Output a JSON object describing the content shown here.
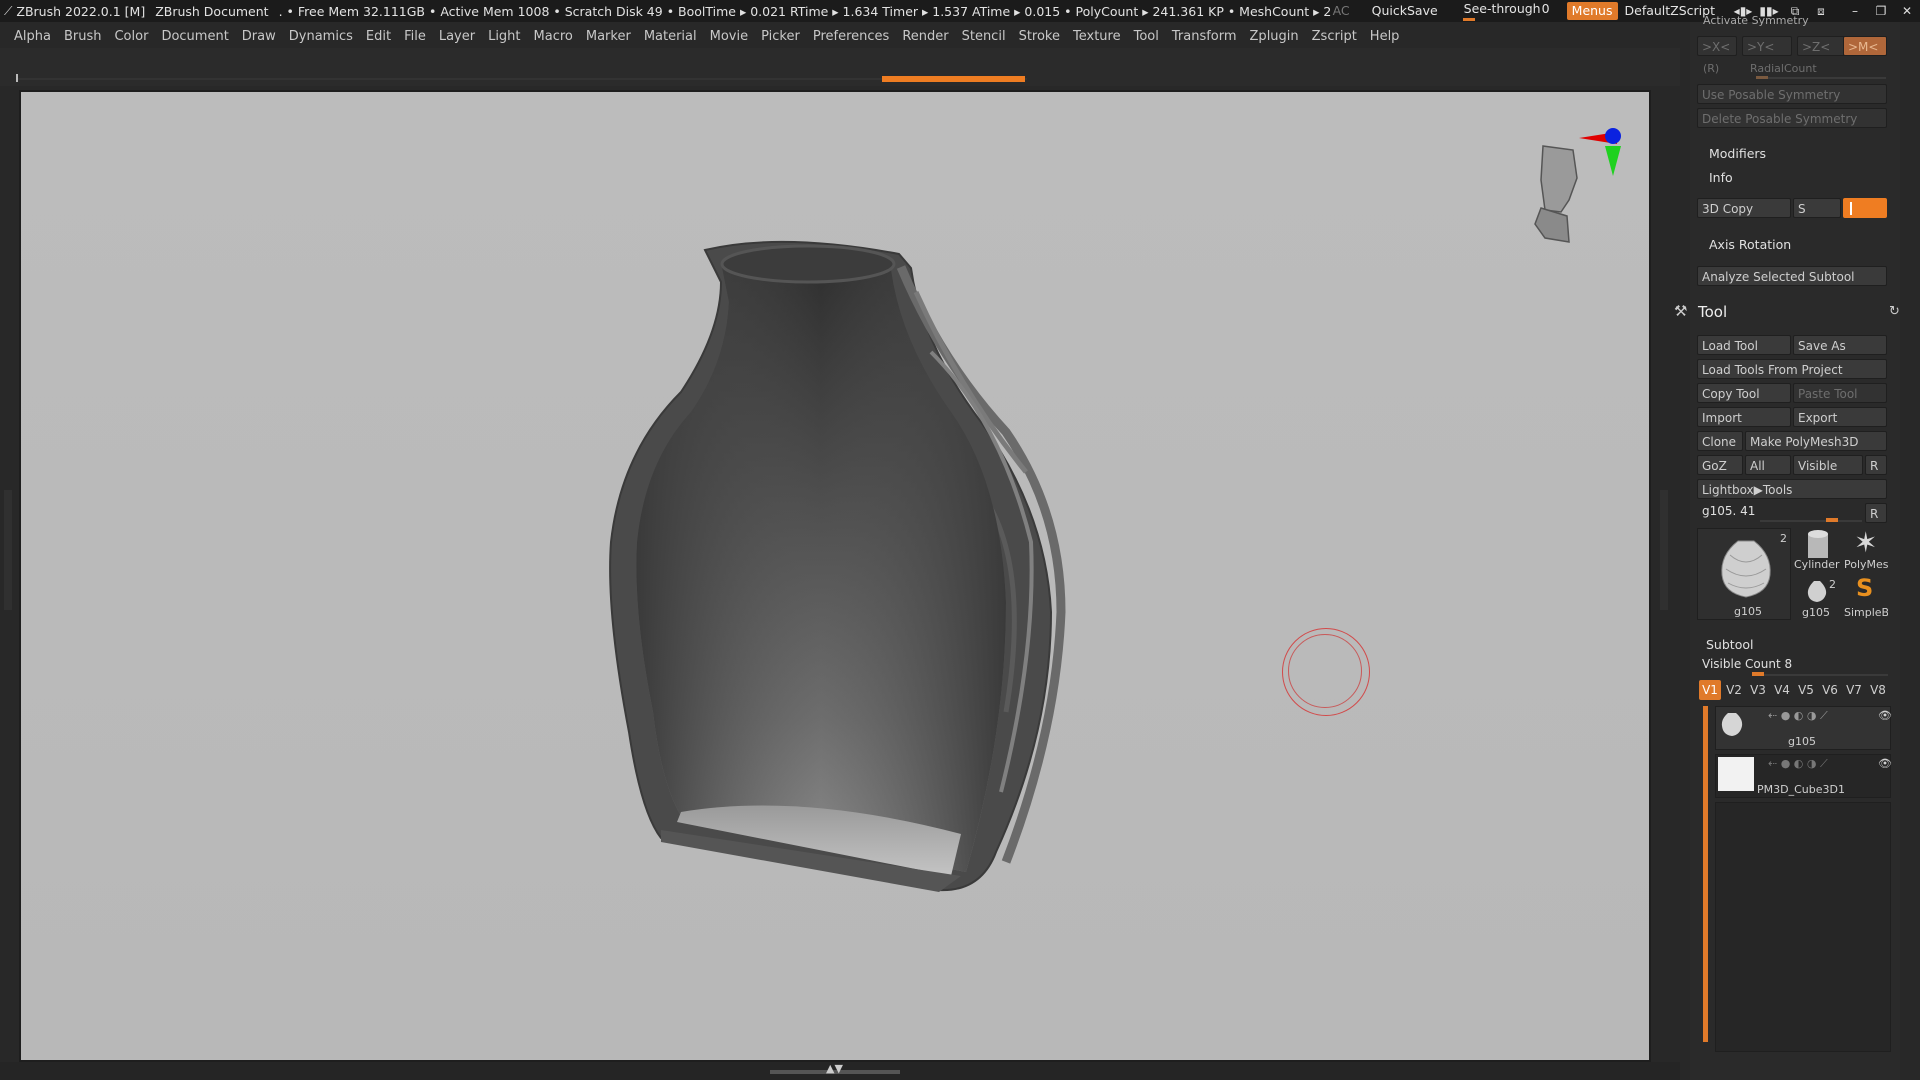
{
  "titlebar": {
    "app": "ZBrush 2022.0.1 [M]",
    "document": "ZBrush Document",
    "stats": ". • Free Mem 32.111GB • Active Mem 1008 • Scratch Disk 49 •  BoolTime ▸ 0.021 RTime ▸ 1.634 Timer ▸ 1.537 ATime ▸ 0.015 • PolyCount ▸ 241.361 KP  • MeshCount ▸ 2",
    "ac": "AC",
    "quicksave": "QuickSave",
    "seethrough": "See-through",
    "seethrough_value": "0",
    "menus": "Menus",
    "zscript": "DefaultZScript"
  },
  "menubar": [
    "Alpha",
    "Brush",
    "Color",
    "Document",
    "Draw",
    "Dynamics",
    "Edit",
    "File",
    "Layer",
    "Light",
    "Macro",
    "Marker",
    "Material",
    "Movie",
    "Picker",
    "Preferences",
    "Render",
    "Stencil",
    "Stroke",
    "Texture",
    "Tool",
    "Transform",
    "Zplugin",
    "Zscript",
    "Help"
  ],
  "panel": {
    "symmetry_header": "Activate Symmetry",
    "sym_x": ">X<",
    "sym_y": ">Y<",
    "sym_z": ">Z<",
    "sym_m": ">M<",
    "radial_r": "(R)",
    "radial_count": "RadialCount",
    "use_posable": "Use Posable Symmetry",
    "delete_posable": "Delete Posable Symmetry",
    "modifiers": "Modifiers",
    "info": "Info",
    "copy3d": "3D Copy",
    "s_label": "S",
    "axis_rotation": "Axis Rotation",
    "analyze": "Analyze Selected Subtool",
    "tool_title": "Tool",
    "load_tool": "Load Tool",
    "save_as": "Save As",
    "load_from_project": "Load Tools From Project",
    "copy_tool": "Copy Tool",
    "paste_tool": "Paste Tool",
    "import": "Import",
    "export": "Export",
    "clone": "Clone",
    "make_polymesh": "Make PolyMesh3D",
    "goz": "GoZ",
    "all": "All",
    "visible": "Visible",
    "r": "R",
    "lightbox": "Lightbox▶Tools",
    "tool_slider_label": "g105. 41",
    "thumb_main_label": "g105",
    "thumb_main_count": "2",
    "thumb_cyl": "Cylinder",
    "thumb_poly": "PolyMes",
    "thumb_g105": "g105",
    "thumb_g105_count": "2",
    "thumb_simple": "SimpleB",
    "subtool": "Subtool",
    "visible_count_label": "Visible Count",
    "visible_count": "8",
    "vtabs": [
      "V1",
      "V2",
      "V3",
      "V4",
      "V5",
      "V6",
      "V7",
      "V8"
    ],
    "subtools": [
      "g105",
      "PM3D_Cube3D1"
    ]
  },
  "colors": {
    "accent": "#e07a2a",
    "viewport_bg": "#bababa",
    "panel_bg": "#2a2a2a"
  }
}
